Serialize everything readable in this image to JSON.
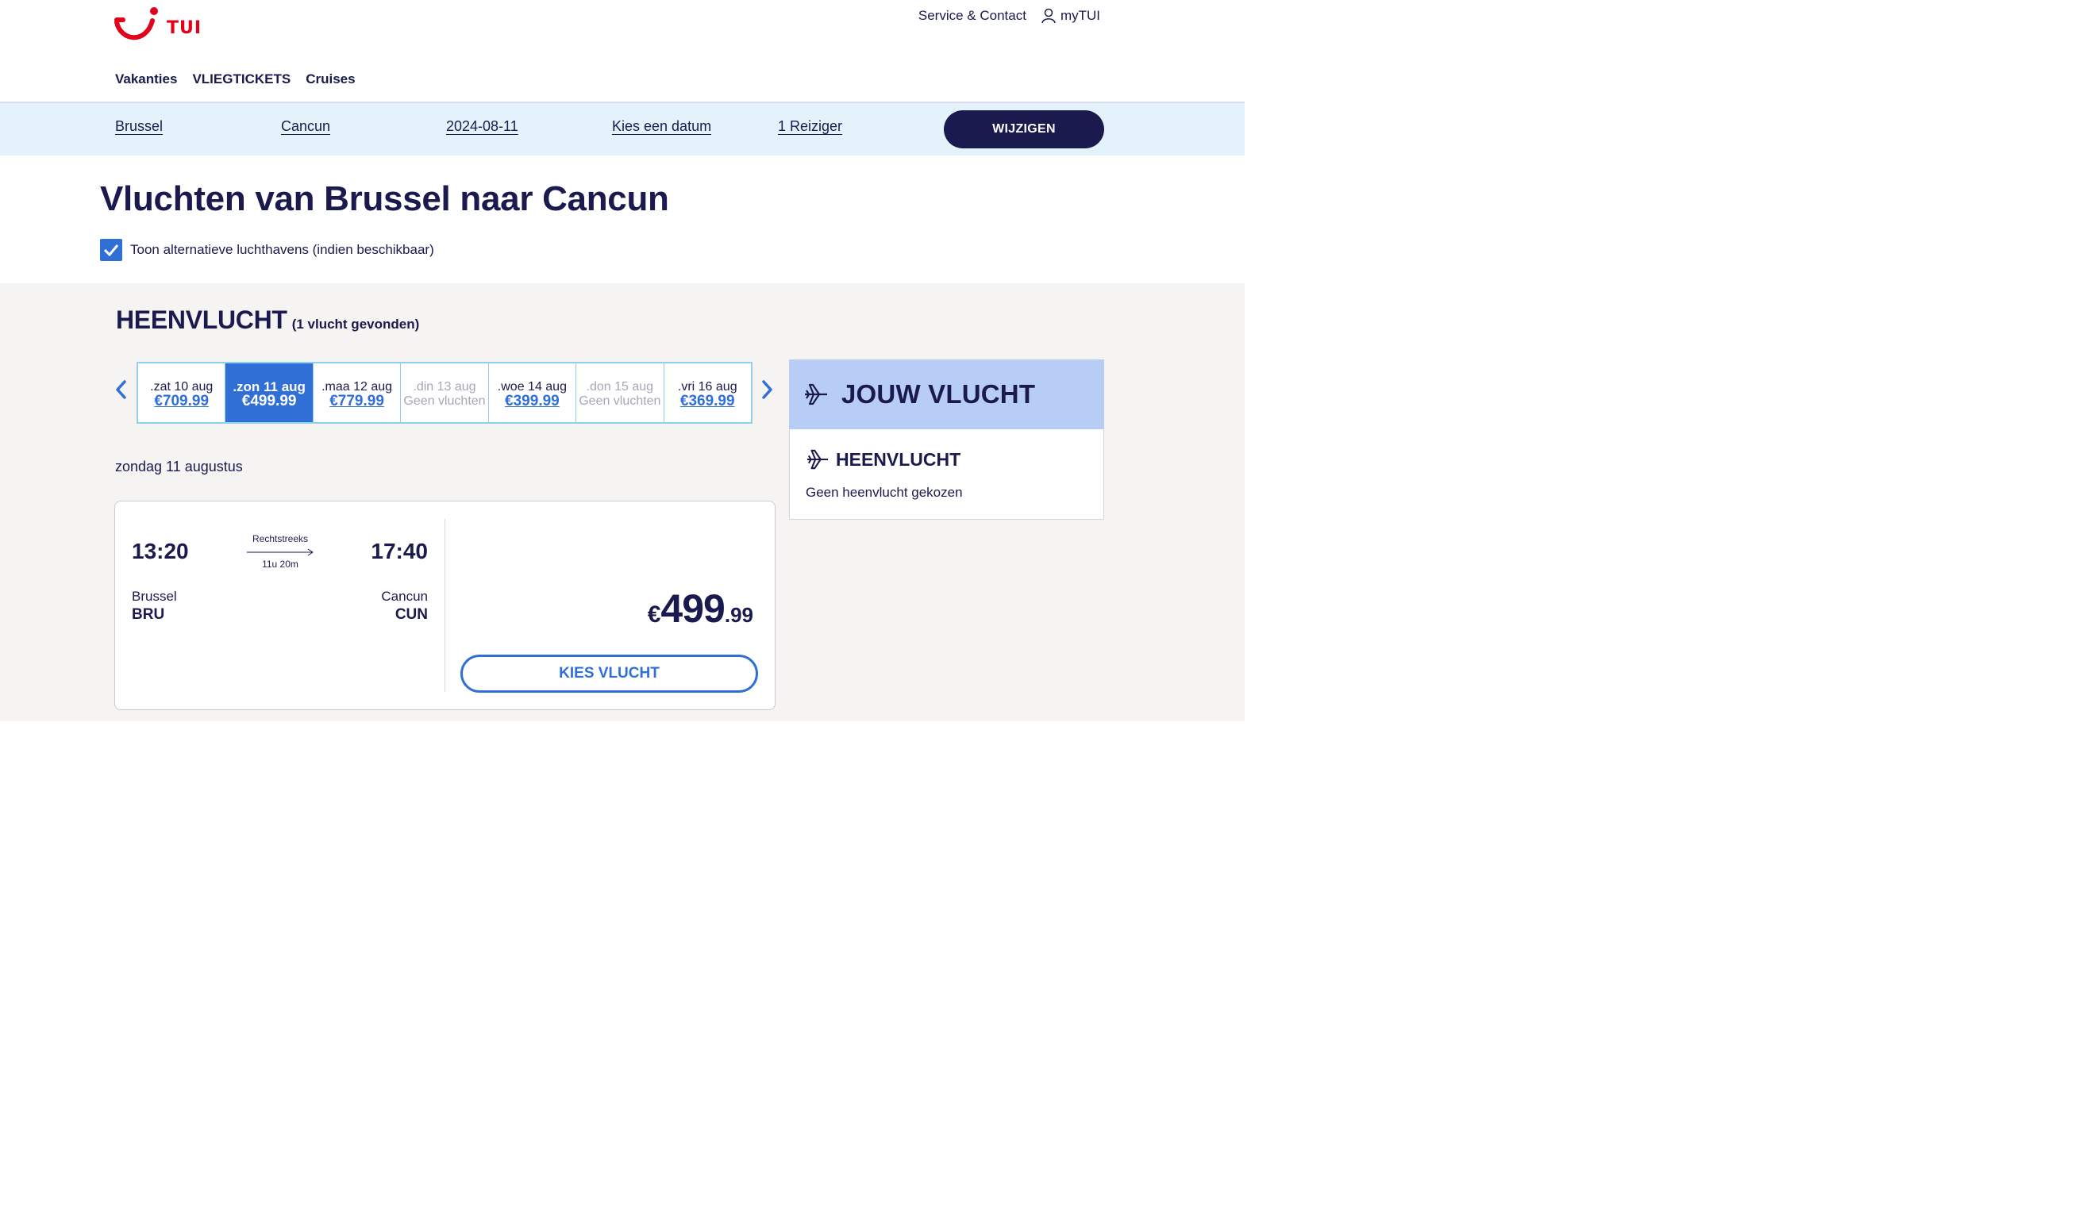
{
  "brand": {
    "name": "TUI",
    "color": "#e2001a"
  },
  "header": {
    "service_link": "Service & Contact",
    "account_link": "myTUI",
    "nav": [
      "Vakanties",
      "VLIEGTICKETS",
      "Cruises"
    ]
  },
  "search": {
    "from": "Brussel",
    "to": "Cancun",
    "depart_date": "2024-08-11",
    "return_date": "Kies een datum",
    "travellers": "1 Reiziger",
    "button": "WIJZIGEN"
  },
  "page": {
    "title": "Vluchten van Brussel naar Cancun",
    "alt_airports_label": "Toon alternatieve luchthavens (indien beschikbaar)",
    "alt_airports_checked": true
  },
  "outbound": {
    "heading": "HEENVLUCHT",
    "count_text": "(1 vlucht gevonden)",
    "dates": [
      {
        "label": ".zat 10 aug",
        "price": "€709.99",
        "state": "available"
      },
      {
        "label": ".zon 11 aug",
        "price": "€499.99",
        "state": "selected"
      },
      {
        "label": ".maa 12 aug",
        "price": "€779.99",
        "state": "available"
      },
      {
        "label": ".din 13 aug",
        "price": "Geen vluchten",
        "state": "disabled"
      },
      {
        "label": ".woe 14 aug",
        "price": "€399.99",
        "state": "available"
      },
      {
        "label": ".don 15 aug",
        "price": "Geen vluchten",
        "state": "disabled"
      },
      {
        "label": ".vri 16 aug",
        "price": "€369.99",
        "state": "available"
      }
    ],
    "day_label": "zondag 11 augustus",
    "flight": {
      "dep_time": "13:20",
      "arr_time": "17:40",
      "type": "Rechtstreeks",
      "duration": "11u 20m",
      "dep_city": "Brussel",
      "dep_code": "BRU",
      "arr_city": "Cancun",
      "arr_code": "CUN",
      "currency": "€",
      "price_int": "499",
      "price_dec": ".99",
      "button": "KIES VLUCHT"
    }
  },
  "summary": {
    "title": "JOUW VLUCHT",
    "leg_title": "HEENVLUCHT",
    "leg_status": "Geen heenvlucht gekozen"
  },
  "colors": {
    "navy": "#1a1a4e",
    "accent_blue": "#2f6fd6",
    "search_bg": "#e4f2fb",
    "summary_header": "#b7cdf6"
  }
}
